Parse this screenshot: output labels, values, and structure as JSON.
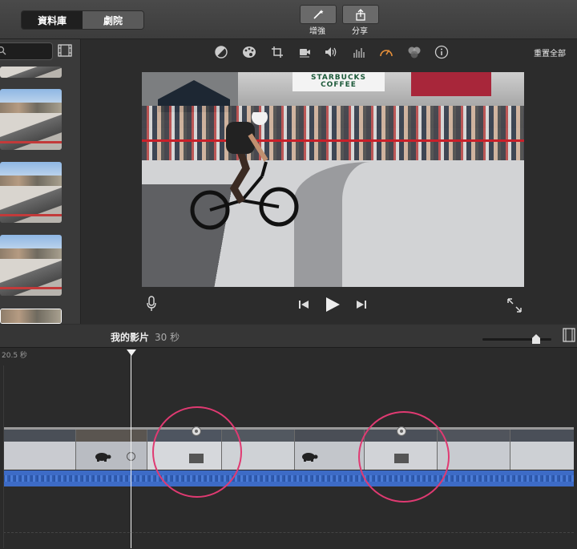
{
  "toolbar": {
    "library_label": "資料庫",
    "theater_label": "劇院",
    "enhance_label": "增強",
    "share_label": "分享"
  },
  "viewer": {
    "reset_all_label": "重置全部",
    "frame_sign_text": "STARBUCKS COFFEE"
  },
  "timeline": {
    "project_title": "我的影片",
    "project_duration": "30 秒",
    "position_label": "20.5 秒"
  },
  "colors": {
    "accent_highlight": "#e03a72",
    "audio_wave": "#3d6bc6",
    "speed_icon_active": "#e8913a"
  },
  "icons": [
    "magic-wand-icon",
    "share-icon",
    "search-icon",
    "film-strip-icon",
    "color-balance-icon",
    "color-palette-icon",
    "crop-icon",
    "stabilization-icon",
    "volume-icon",
    "equalizer-icon",
    "speedometer-icon",
    "clip-filter-icon",
    "info-icon",
    "microphone-icon",
    "skip-back-icon",
    "play-icon",
    "skip-forward-icon",
    "fullscreen-icon",
    "turtle-icon",
    "rabbit-icon"
  ]
}
